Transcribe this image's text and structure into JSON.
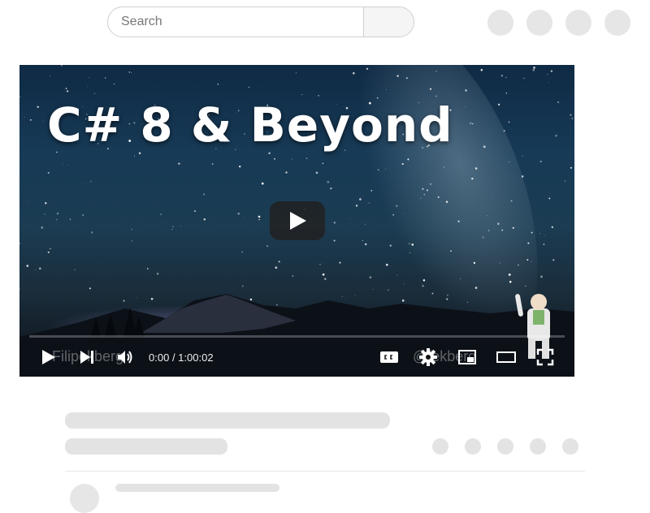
{
  "search": {
    "placeholder": "Search"
  },
  "video": {
    "title": "C# 8 & Beyond",
    "current_time": "0:00",
    "duration": "1:00:02",
    "watermark_left": "Filipekberg",
    "watermark_right": "@fekberg",
    "progress_fraction": 0
  },
  "colors": {
    "player_bg": "#0f2a44",
    "skeleton": "#e3e3e3",
    "control_icon": "#ffffff"
  },
  "icons": {
    "big_play": "play-icon",
    "play": "play-icon",
    "next": "skip-next-icon",
    "volume": "volume-icon",
    "captions": "captions-icon",
    "settings": "gear-icon",
    "miniplayer": "miniplayer-icon",
    "theater": "theater-mode-icon",
    "fullscreen": "fullscreen-icon"
  }
}
